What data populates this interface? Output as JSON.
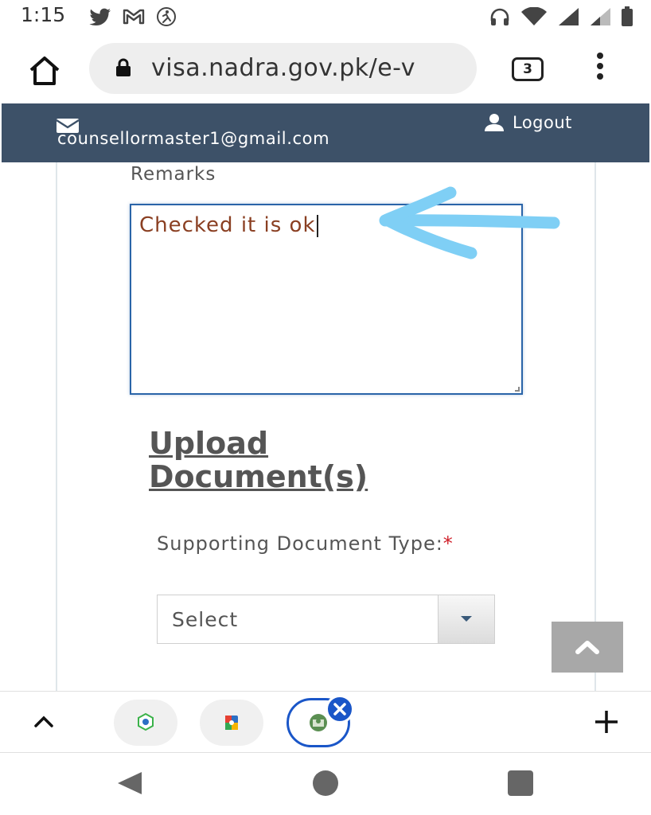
{
  "status_bar": {
    "time": "1:15",
    "left_icons": [
      "twitter-icon",
      "gmail-icon",
      "accessibility-icon"
    ],
    "right_icons": [
      "headphones-icon",
      "wifi-icon",
      "signal-icon",
      "signal-weak-icon",
      "battery-icon"
    ]
  },
  "browser": {
    "url": "visa.nadra.gov.pk/e-v",
    "tab_count": "3"
  },
  "header": {
    "email": "counsellormaster1@gmail.com",
    "logout_label": "Logout",
    "background_color": "#3d5168"
  },
  "form": {
    "remarks_label": "Remarks",
    "remarks_value": "Checked it is ok",
    "upload_title": "Upload Document(s)",
    "doc_type_label": "Supporting Document Type:",
    "required_mark": "*",
    "select_value": "Select"
  },
  "annotation": {
    "type": "hand-drawn-arrow",
    "color": "#7fcff5"
  },
  "tab_strip": {
    "tabs": [
      "tab-thumb-1",
      "tab-thumb-2",
      "tab-thumb-3"
    ],
    "active_tab_index": 2,
    "active_color": "#1a56c8"
  }
}
